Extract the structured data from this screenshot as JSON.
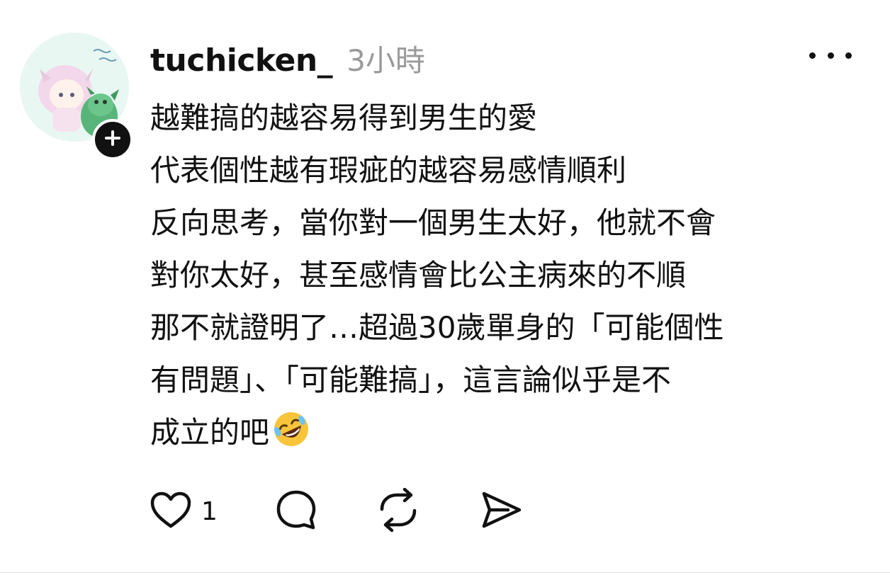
{
  "post": {
    "username": "tuchicken_",
    "timestamp": "3小時",
    "lines": [
      "越難搞的越容易得到男生的愛",
      "代表個性越有瑕疵的越容易感情順利",
      "反向思考，當你對一個男生太好，他就不會",
      "對你太好，甚至感情會比公主病來的不順",
      "那不就證明了…超過30歲單身的「可能個性",
      "有問題」、「可能難搞」，這言論似乎是不",
      "成立的吧"
    ],
    "emoji": "rolling-on-the-floor-laughing-emoji",
    "likes_count": "1"
  },
  "icons": {
    "more": "more-options-icon",
    "like": "heart-icon",
    "reply": "comment-icon",
    "repost": "repost-icon",
    "share": "send-icon",
    "follow": "plus-icon"
  },
  "colors": {
    "text": "#111111",
    "muted": "#9a9a9a",
    "background": "#ffffff",
    "emoji_face": "#f8c43a"
  }
}
